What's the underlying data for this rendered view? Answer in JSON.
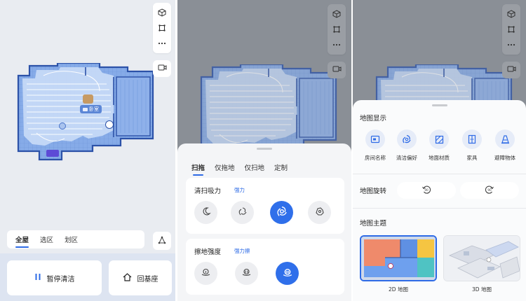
{
  "map": {
    "room_label": "卧室",
    "tool_icons": [
      "cube-3d-icon",
      "crop-frame-icon",
      "more-dots-icon"
    ],
    "camera_icon": "camera-icon"
  },
  "home_panel": {
    "tabs": [
      "全屋",
      "选区",
      "划区"
    ],
    "active_tab": "全屋",
    "pause_label": "暂停清洁",
    "dock_label": "回基座"
  },
  "clean_sheet": {
    "mode_tabs": [
      "扫拖",
      "仅拖地",
      "仅扫地",
      "定制"
    ],
    "active_mode": "扫拖",
    "suction": {
      "title": "清扫吸力",
      "value": "强力",
      "options": [
        "quiet-moon-icon",
        "standard-swirl-icon",
        "strong-swirl-icon",
        "max-swirl-icon"
      ],
      "selected_index": 2
    },
    "mop": {
      "title": "擦地强度",
      "value": "强力擦",
      "options": [
        "mop-low-icon",
        "mop-medium-icon",
        "mop-high-icon"
      ],
      "selected_index": 2
    }
  },
  "map_settings": {
    "display": {
      "title": "地图显示",
      "items": [
        {
          "label": "房间名称",
          "icon": "room-name-icon"
        },
        {
          "label": "清洁偏好",
          "icon": "clean-preference-icon"
        },
        {
          "label": "地面材质",
          "icon": "floor-material-icon"
        },
        {
          "label": "家具",
          "icon": "furniture-icon"
        },
        {
          "label": "避障物体",
          "icon": "obstacle-icon"
        }
      ]
    },
    "rotation": {
      "title": "地图旋转",
      "options": [
        "rotate-ccw-90-icon",
        "rotate-cw-90-icon"
      ]
    },
    "theme": {
      "title": "地图主题",
      "options": [
        "2D 地图",
        "3D 地图"
      ],
      "selected": "2D 地图"
    }
  },
  "colors": {
    "accent": "#2e6be6",
    "map_fill": "#7aa4e6",
    "map_wall": "#2c52a8"
  }
}
